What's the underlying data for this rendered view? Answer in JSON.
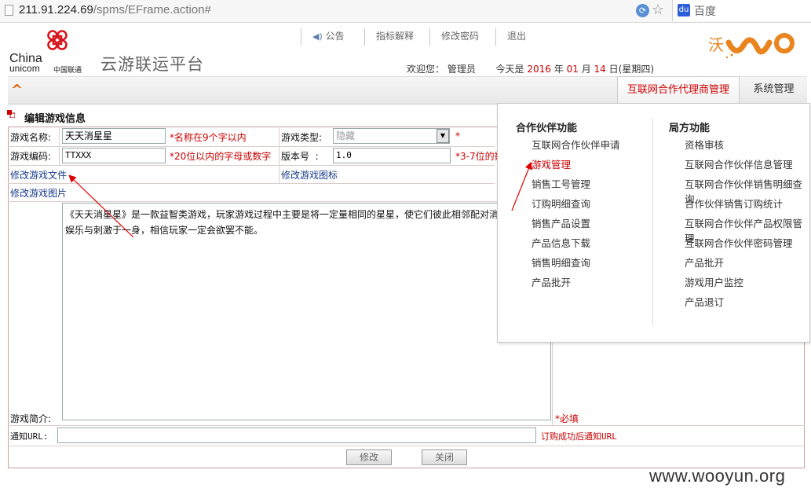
{
  "browser": {
    "url_host": "211.91.224.69",
    "url_path": "/spms/EFrame.action#",
    "search_placeholder": "百度",
    "reload_glyph": "⟳",
    "star_glyph": "☆",
    "baidu_glyph": "du"
  },
  "header": {
    "logo_en_line1": "China",
    "logo_en_line2": "unicom",
    "logo_cn": "中国联通",
    "platform_title": "云游联运平台",
    "top_nav": [
      "公告",
      "指标解释",
      "修改密码",
      "退出"
    ],
    "welcome_label": "欢迎您：",
    "user": "管理员",
    "today_label": "今天是",
    "year": "2016",
    "year_unit": "年",
    "month": "01",
    "month_unit": "月",
    "day": "14",
    "day_unit": "日",
    "weekday": "(星期四)",
    "brand_color": "#e9841e"
  },
  "nav": {
    "collapse_glyph": "^",
    "tabs": [
      "互联网合作代理商管理",
      "系统管理"
    ],
    "active_tab": "互联网合作代理商管理"
  },
  "form": {
    "title": "编辑游戏信息",
    "name_label": "游戏名称:",
    "name_value": "天天消星星",
    "name_hint": "*名称在9个字以内",
    "type_label": "游戏类型:",
    "type_value": "隐藏",
    "type_required": "*",
    "code_label": "游戏编码:",
    "code_value": "TTXXX",
    "code_hint": "*20位以内的字母或数字",
    "version_label": "版本号  :",
    "version_value": "1.0",
    "version_hint": "*3-7位的数",
    "edit_file_link": "修改游戏文件",
    "edit_icon_link": "修改游戏图标",
    "edit_image_link": "修改游戏图片",
    "desc_label": "游戏简介:",
    "desc_value": "《天天消星星》是一款益智类游戏，玩家游戏过程中主要是将一定量相同的星星，使它们彼此相邻配对消除。游戏集娱乐与刺激于一身，相信玩家一定会欲罢不能。",
    "desc_required": "*必填",
    "notify_label": "通知URL:",
    "notify_hint": "订购成功后通知URL",
    "save_label": "修改",
    "close_label": "关闭",
    "required_color": "#cc0000"
  },
  "dropdown": {
    "col1_title": "合作伙伴功能",
    "col1_items": [
      "互联网合作伙伴申请",
      "游戏管理",
      "销售工号管理",
      "订购明细查询",
      "销售产品设置",
      "产品信息下载",
      "销售明细查询",
      "产品批开"
    ],
    "col1_active": "游戏管理",
    "col2_title": "局方功能",
    "col2_items": [
      "资格审核",
      "互联网合作伙伴信息管理",
      "互联网合作伙伴销售明细查询",
      "合作伙伴销售订购统计",
      "互联网合作伙伴产品权限管理",
      "互联网合作伙伴密码管理",
      "产品批开",
      "游戏用户监控",
      "产品退订"
    ],
    "active_color": "#cc0000"
  },
  "watermark": "www.wooyun.org"
}
